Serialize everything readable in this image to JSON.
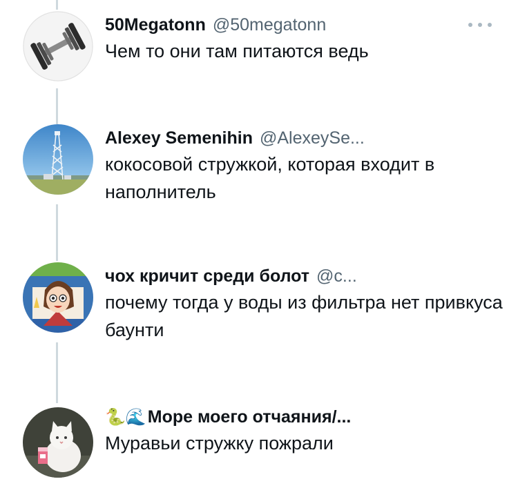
{
  "thread": {
    "tweets": [
      {
        "name": "50Megatonn",
        "handle": "@50megatonn",
        "text": "Чем то они там питаются ведь",
        "avatar_icon": "dumbbell-icon",
        "has_more_menu": true
      },
      {
        "name": "Alexey Semenihin",
        "handle": "@AlexeySe...",
        "text": "кокосовой стружкой, которая входит в наполнитель",
        "avatar_icon": "radio-tower-icon"
      },
      {
        "name": "чох кричит среди болот",
        "handle": "@c...",
        "text": "почему тогда у воды из фильтра нет привкуса баунти",
        "avatar_icon": "cartoon-character-icon"
      },
      {
        "name_emoji": "🐍🌊",
        "name": "Море моего отчаяния/...",
        "handle": "",
        "text": "Муравьи стружку пожрали",
        "avatar_icon": "white-cat-icon"
      }
    ]
  },
  "colors": {
    "text": "#0f1419",
    "secondary_text": "#536471",
    "thread_line": "#cfd9de"
  }
}
